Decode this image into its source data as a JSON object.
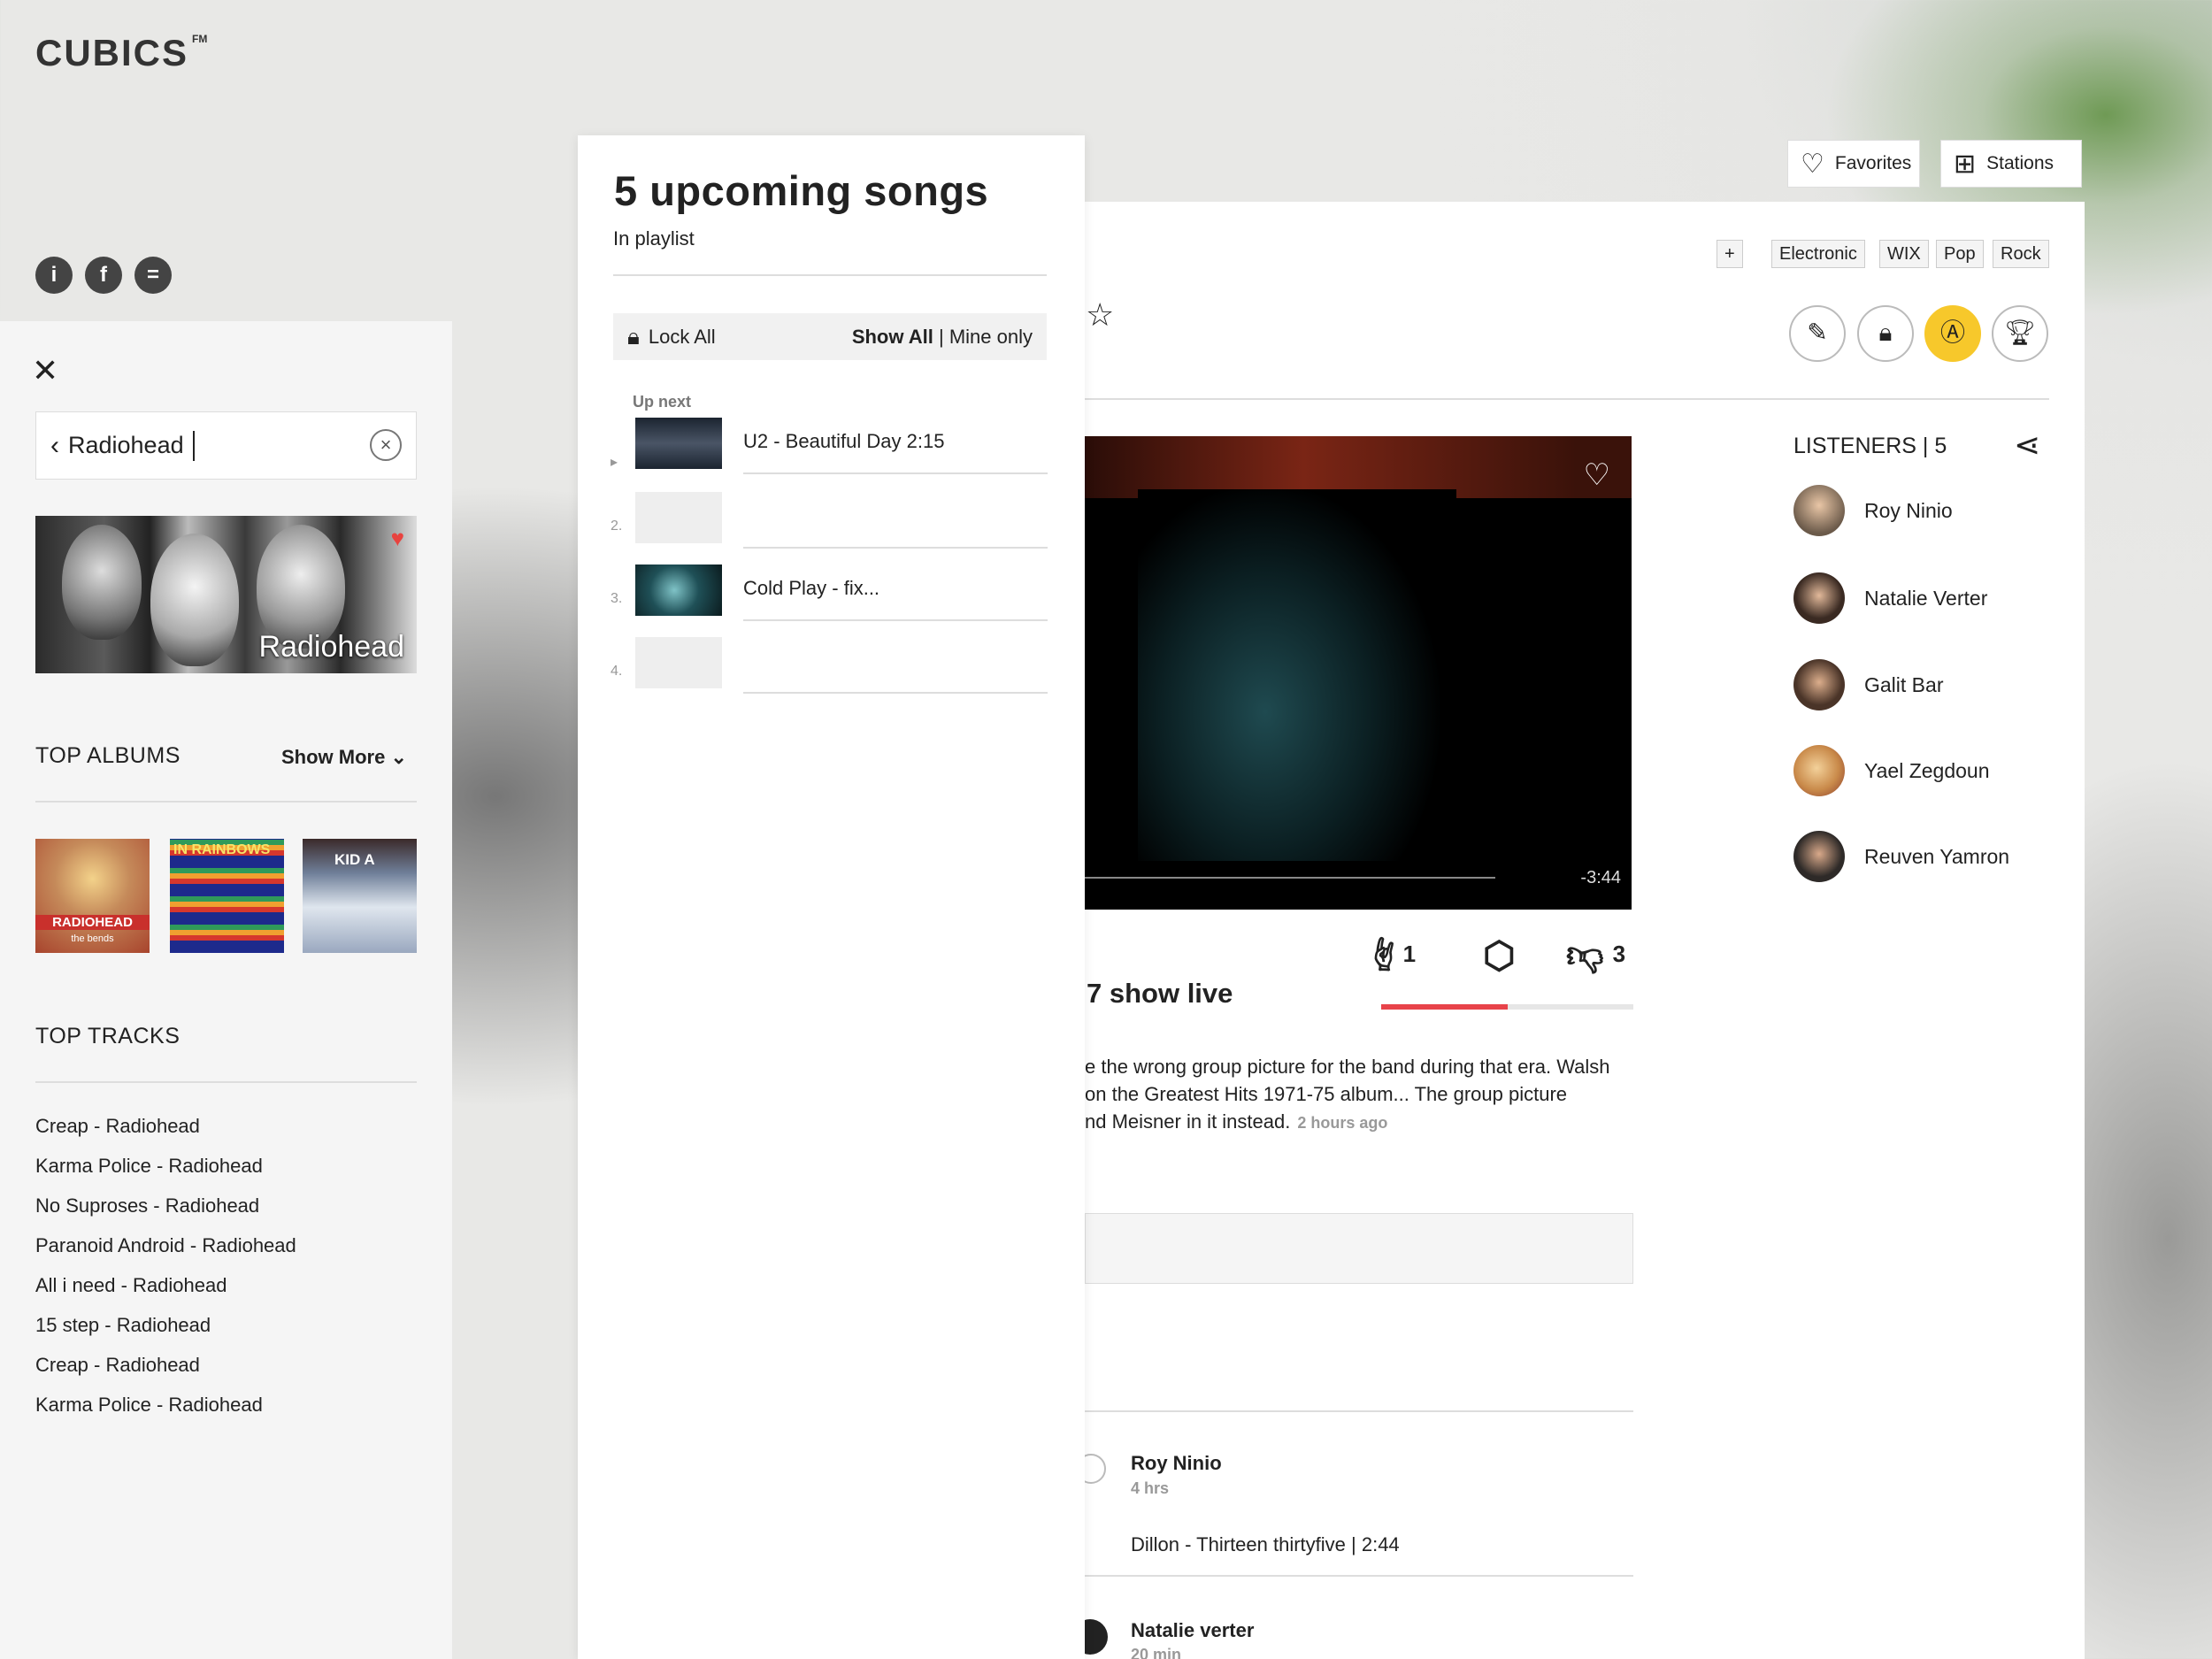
{
  "app": {
    "logo": "CUBICS",
    "logo_sup": "FM"
  },
  "social": {
    "info_icon": "i",
    "facebook_icon": "f",
    "chat_icon": "="
  },
  "search": {
    "value": "Radiohead",
    "back_icon": "‹",
    "clear_icon": "×"
  },
  "artist_card": {
    "name": "Radiohead"
  },
  "top_albums": {
    "heading": "TOP ALBUMS",
    "show_more": "Show More",
    "albums": [
      {
        "title": "RADIOHEAD",
        "subtitle": "the bends",
        "color": "#a8442d"
      },
      {
        "title": "IN RAINBOWS",
        "color": "#1d2a8c"
      },
      {
        "title": "KID A",
        "color": "#6f7f99"
      }
    ]
  },
  "top_tracks": {
    "heading": "TOP TRACKS",
    "items": [
      "Creap - Radiohead",
      "Karma Police - Radiohead",
      "No Suproses - Radiohead",
      "Paranoid Android - Radiohead",
      "All i need - Radiohead",
      "15 step - Radiohead",
      "Creap - Radiohead",
      "Karma Police - Radiohead"
    ]
  },
  "playlist": {
    "title": "5 upcoming songs",
    "subtitle": "In playlist",
    "lock_all": "Lock All",
    "show_all": "Show All",
    "separator": " | ",
    "mine_only": "Mine only",
    "up_next": "Up next",
    "rows": [
      {
        "num": "▸",
        "text": "U2 - Beautiful Day 2:15"
      },
      {
        "num": "2.",
        "text": ""
      },
      {
        "num": "3.",
        "text": "Cold Play  - fix..."
      },
      {
        "num": "4.",
        "text": ""
      }
    ]
  },
  "header": {
    "favorites": "Favorites",
    "stations": "Stations",
    "tags": [
      "+",
      "Electronic",
      "WIX",
      "Pop",
      "Rock"
    ]
  },
  "video": {
    "remaining": "-3:44",
    "progress": 0.75
  },
  "reactions": {
    "rock": "1",
    "dislike": "3",
    "vote_fraction": 0.5
  },
  "song": {
    "title_partial": "7 show live",
    "description_lines": [
      "e the wrong group picture for the band during that era. Walsh",
      "on the Greatest Hits 1971-75 album... The group picture",
      "nd Meisner in it instead."
    ],
    "time_ago": "2 hours ago"
  },
  "listeners": {
    "heading": "LISTENERS | 5",
    "people": [
      {
        "name": "Roy Ninio",
        "color": "#6b5a4a"
      },
      {
        "name": "Natalie Verter",
        "color": "#3a2a22"
      },
      {
        "name": "Galit Bar",
        "color": "#4a3428"
      },
      {
        "name": "Yael Zegdoun",
        "color": "#c98a4a"
      },
      {
        "name": "Reuven Yamron",
        "color": "#2e2a28"
      }
    ]
  },
  "comments": [
    {
      "name": "Roy Ninio",
      "time": "4 hrs",
      "song": "Dillon - Thirteen thirtyfive | 2:44"
    },
    {
      "name": "Natalie verter",
      "time": "20 min"
    }
  ]
}
